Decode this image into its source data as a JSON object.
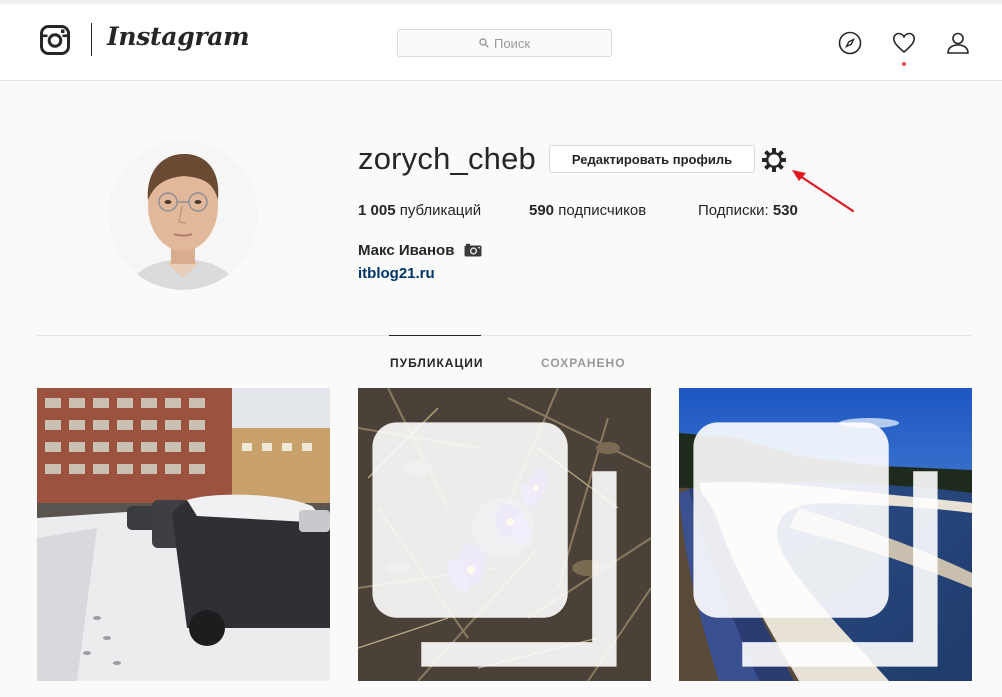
{
  "header": {
    "wordmark": "Instagram",
    "search_placeholder": "Поиск",
    "icons": [
      "instagram-logo-icon",
      "search-icon",
      "compass-icon",
      "heart-icon",
      "profile-icon"
    ],
    "notification_dot_color": "#ed4956"
  },
  "profile": {
    "username": "zorych_cheb",
    "edit_button_label": "Редактировать профиль",
    "settings_icon": "gear-icon",
    "annotation_arrow_color": "#e0181e",
    "stats": {
      "posts_count": "1 005",
      "posts_label": "публикаций",
      "followers_count": "590",
      "followers_label": "подписчиков",
      "following_label": "Подписки:",
      "following_count": "530"
    },
    "full_name": "Макс Иванов",
    "website": "itblog21.ru",
    "link_color": "#003569"
  },
  "tabs": {
    "items": [
      {
        "label": "ПУБЛИКАЦИИ",
        "active": true
      },
      {
        "label": "СОХРАНЕНО",
        "active": false
      }
    ]
  },
  "posts": [
    {
      "subject": "snowy-street-cars",
      "multiple": false
    },
    {
      "subject": "purple-pasque-flowers",
      "multiple": true
    },
    {
      "subject": "river-with-melting-ice",
      "multiple": true
    }
  ]
}
